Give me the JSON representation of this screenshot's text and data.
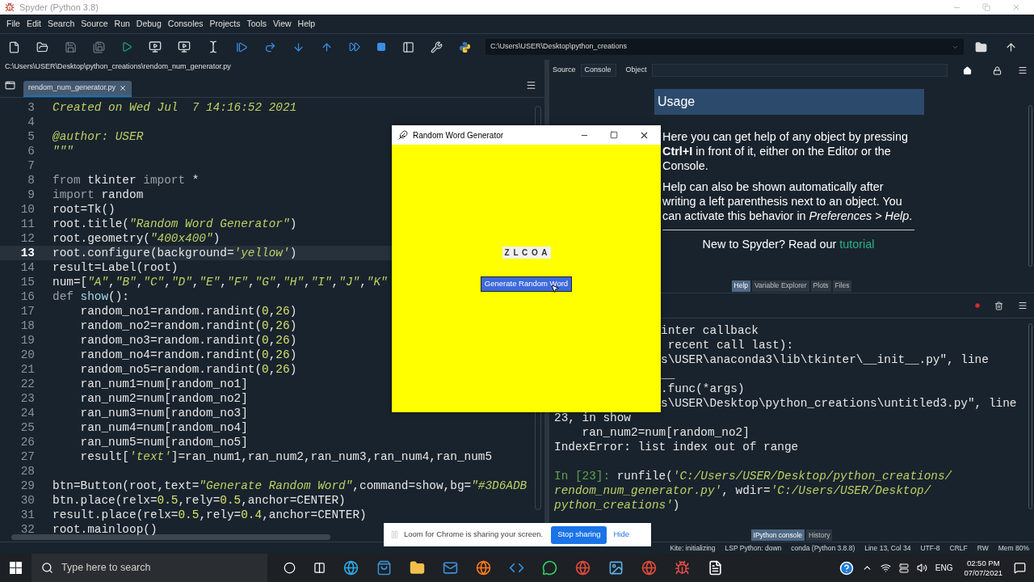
{
  "window": {
    "title": "Spyder (Python 3.8)"
  },
  "menu": [
    "File",
    "Edit",
    "Search",
    "Source",
    "Run",
    "Debug",
    "Consoles",
    "Projects",
    "Tools",
    "View",
    "Help"
  ],
  "toolbar": {
    "working_directory": "C:\\Users\\USER\\Desktop\\python_creations"
  },
  "editor": {
    "file_path": "C:\\Users\\USER\\Desktop\\python_creations\\rendom_num_generator.py",
    "tabs": [
      {
        "label": "rendom_num_generator.py",
        "selected": true
      }
    ],
    "lines": [
      {
        "number": "3",
        "current": false,
        "tokens": [
          {
            "kind": "doc",
            "text": "Created on Wed Jul  7 14:16:52 2021"
          }
        ]
      },
      {
        "number": "4",
        "current": false
      },
      {
        "number": "5",
        "current": false,
        "tokens": [
          {
            "kind": "doc",
            "text": "@author: USER"
          }
        ]
      },
      {
        "number": "6",
        "current": false,
        "tokens": [
          {
            "kind": "doc",
            "text": "\"\"\""
          }
        ]
      },
      {
        "number": "7",
        "current": false
      },
      {
        "number": "8",
        "current": false,
        "tokens": [
          {
            "kind": "kw",
            "text": "from"
          },
          {
            "kind": "plain",
            "text": " tkinter "
          },
          {
            "kind": "kw",
            "text": "import"
          },
          {
            "kind": "plain",
            "text": " *"
          }
        ]
      },
      {
        "number": "9",
        "current": false,
        "tokens": [
          {
            "kind": "kw",
            "text": "import"
          },
          {
            "kind": "plain",
            "text": " random"
          }
        ]
      },
      {
        "number": "10",
        "current": false,
        "tokens": [
          {
            "kind": "plain",
            "text": "root=Tk()"
          }
        ]
      },
      {
        "number": "11",
        "current": false,
        "tokens": [
          {
            "kind": "plain",
            "text": "root.title("
          },
          {
            "kind": "str",
            "text": "\"Random Word Generator\""
          },
          {
            "kind": "plain",
            "text": ")"
          }
        ]
      },
      {
        "number": "12",
        "current": false,
        "tokens": [
          {
            "kind": "plain",
            "text": "root.geometry("
          },
          {
            "kind": "str",
            "text": "\"400x400\""
          },
          {
            "kind": "plain",
            "text": ")"
          }
        ]
      },
      {
        "number": "13",
        "current": true,
        "tokens": [
          {
            "kind": "plain",
            "text": "root.configure(background="
          },
          {
            "kind": "str",
            "text": "'yellow'"
          },
          {
            "kind": "plain",
            "text": ")"
          }
        ]
      },
      {
        "number": "14",
        "current": false,
        "tokens": [
          {
            "kind": "plain",
            "text": "result=Label(root)"
          }
        ]
      },
      {
        "number": "15",
        "current": false,
        "tokens": [
          {
            "kind": "plain",
            "text": "num=["
          },
          {
            "kind": "str",
            "text": "\"A\""
          },
          {
            "kind": "plain",
            "text": ","
          },
          {
            "kind": "str",
            "text": "\"B\""
          },
          {
            "kind": "plain",
            "text": ","
          },
          {
            "kind": "str",
            "text": "\"C\""
          },
          {
            "kind": "plain",
            "text": ","
          },
          {
            "kind": "str",
            "text": "\"D\""
          },
          {
            "kind": "plain",
            "text": ","
          },
          {
            "kind": "str",
            "text": "\"E\""
          },
          {
            "kind": "plain",
            "text": ","
          },
          {
            "kind": "str",
            "text": "\"F\""
          },
          {
            "kind": "plain",
            "text": ","
          },
          {
            "kind": "str",
            "text": "\"G\""
          },
          {
            "kind": "plain",
            "text": ","
          },
          {
            "kind": "str",
            "text": "\"H\""
          },
          {
            "kind": "plain",
            "text": ","
          },
          {
            "kind": "str",
            "text": "\"I\""
          },
          {
            "kind": "plain",
            "text": ","
          },
          {
            "kind": "str",
            "text": "\"J\""
          },
          {
            "kind": "plain",
            "text": ","
          },
          {
            "kind": "str",
            "text": "\"K\""
          }
        ]
      },
      {
        "number": "16",
        "current": false,
        "tokens": [
          {
            "kind": "kw",
            "text": "def "
          },
          {
            "kind": "fn",
            "text": "show"
          },
          {
            "kind": "plain",
            "text": "():"
          }
        ]
      },
      {
        "number": "17",
        "current": false,
        "tokens": [
          {
            "kind": "plain",
            "text": "    random_no1=random.randint("
          },
          {
            "kind": "num",
            "text": "0"
          },
          {
            "kind": "plain",
            "text": ","
          },
          {
            "kind": "num",
            "text": "26"
          },
          {
            "kind": "plain",
            "text": ")"
          }
        ]
      },
      {
        "number": "18",
        "current": false,
        "tokens": [
          {
            "kind": "plain",
            "text": "    random_no2=random.randint("
          },
          {
            "kind": "num",
            "text": "0"
          },
          {
            "kind": "plain",
            "text": ","
          },
          {
            "kind": "num",
            "text": "26"
          },
          {
            "kind": "plain",
            "text": ")"
          }
        ]
      },
      {
        "number": "19",
        "current": false,
        "tokens": [
          {
            "kind": "plain",
            "text": "    random_no3=random.randint("
          },
          {
            "kind": "num",
            "text": "0"
          },
          {
            "kind": "plain",
            "text": ","
          },
          {
            "kind": "num",
            "text": "26"
          },
          {
            "kind": "plain",
            "text": ")"
          }
        ]
      },
      {
        "number": "20",
        "current": false,
        "tokens": [
          {
            "kind": "plain",
            "text": "    random_no4=random.randint("
          },
          {
            "kind": "num",
            "text": "0"
          },
          {
            "kind": "plain",
            "text": ","
          },
          {
            "kind": "num",
            "text": "26"
          },
          {
            "kind": "plain",
            "text": ")"
          }
        ]
      },
      {
        "number": "21",
        "current": false,
        "tokens": [
          {
            "kind": "plain",
            "text": "    random_no5=random.randint("
          },
          {
            "kind": "num",
            "text": "0"
          },
          {
            "kind": "plain",
            "text": ","
          },
          {
            "kind": "num",
            "text": "26"
          },
          {
            "kind": "plain",
            "text": ")"
          }
        ]
      },
      {
        "number": "22",
        "current": false,
        "tokens": [
          {
            "kind": "plain",
            "text": "    ran_num1=num[random_no1]"
          }
        ]
      },
      {
        "number": "23",
        "current": false,
        "tokens": [
          {
            "kind": "plain",
            "text": "    ran_num2=num[random_no2]"
          }
        ]
      },
      {
        "number": "24",
        "current": false,
        "tokens": [
          {
            "kind": "plain",
            "text": "    ran_num3=num[random_no3]"
          }
        ]
      },
      {
        "number": "25",
        "current": false,
        "tokens": [
          {
            "kind": "plain",
            "text": "    ran_num4=num[random_no4]"
          }
        ]
      },
      {
        "number": "26",
        "current": false,
        "tokens": [
          {
            "kind": "plain",
            "text": "    ran_num5=num[random_no5]"
          }
        ]
      },
      {
        "number": "27",
        "current": false,
        "tokens": [
          {
            "kind": "plain",
            "text": "    result["
          },
          {
            "kind": "str",
            "text": "'text'"
          },
          {
            "kind": "plain",
            "text": "]=ran_num1,ran_num2,ran_num3,ran_num4,ran_num5"
          }
        ]
      },
      {
        "number": "28",
        "current": false
      },
      {
        "number": "29",
        "current": false,
        "tokens": [
          {
            "kind": "plain",
            "text": "btn=Button(root,text="
          },
          {
            "kind": "str",
            "text": "\"Generate Random Word\""
          },
          {
            "kind": "plain",
            "text": ",command=show,bg="
          },
          {
            "kind": "str",
            "text": "\"#3D6ADB"
          }
        ]
      },
      {
        "number": "30",
        "current": false,
        "tokens": [
          {
            "kind": "plain",
            "text": "btn.place(relx="
          },
          {
            "kind": "num",
            "text": "0.5"
          },
          {
            "kind": "plain",
            "text": ",rely="
          },
          {
            "kind": "num",
            "text": "0.5"
          },
          {
            "kind": "plain",
            "text": ",anchor=CENTER)"
          }
        ]
      },
      {
        "number": "31",
        "current": false,
        "tokens": [
          {
            "kind": "plain",
            "text": "result.place(relx="
          },
          {
            "kind": "num",
            "text": "0.5"
          },
          {
            "kind": "plain",
            "text": ",rely="
          },
          {
            "kind": "num",
            "text": "0.4"
          },
          {
            "kind": "plain",
            "text": ",anchor=CENTER)"
          }
        ]
      },
      {
        "number": "32",
        "current": false,
        "tokens": [
          {
            "kind": "plain",
            "text": "root.mainloop()"
          }
        ]
      }
    ]
  },
  "help": {
    "source_label": "Source",
    "source_value": "Console",
    "object_label": "Object",
    "title": "Usage",
    "paragraphs": [
      "Here you can get help of any object by pressing **Ctrl+I** in front of it, either on the Editor or the Console.",
      "Help can also be shown automatically after writing a left parenthesis next to an object. You can activate this behavior in *Preferences > Help*."
    ],
    "footer_text": "New to Spyder? Read our",
    "footer_link": "tutorial",
    "tabs": [
      {
        "label": "Help",
        "selected": true
      },
      {
        "label": "Variable Explorer",
        "selected": false
      },
      {
        "label": "Plots",
        "selected": false
      },
      {
        "label": "Files",
        "selected": false
      }
    ]
  },
  "console": {
    "lines": [
      {
        "kind": "partial",
        "tokens": [
          {
            "kind": "plain",
            "text": "inter callback"
          }
        ]
      },
      {
        "kind": "partial",
        "tokens": [
          {
            "kind": "plain",
            "text": " recent call last):"
          }
        ]
      },
      {
        "kind": "partial",
        "tokens": [
          {
            "kind": "plain",
            "text": "s\\USER\\anaconda3\\lib\\tkinter\\__init__.py\", line"
          }
        ]
      },
      {
        "kind": "partial",
        "tokens": [
          {
            "kind": "plain",
            "text": "__"
          }
        ]
      },
      {
        "kind": "partial",
        "tokens": [
          {
            "kind": "plain",
            "text": ".func(*args)"
          }
        ]
      },
      {
        "kind": "partial",
        "tokens": [
          {
            "kind": "plain",
            "text": "s\\USER\\Desktop\\python_creations\\untitled3.py\", line"
          }
        ]
      },
      {
        "kind": "full",
        "tokens": [
          {
            "kind": "plain",
            "text": "23, in show"
          }
        ]
      },
      {
        "kind": "full",
        "tokens": [
          {
            "kind": "plain",
            "text": "    ran_num2=num[random_no2]"
          }
        ]
      },
      {
        "kind": "full",
        "tokens": [
          {
            "kind": "plain",
            "text": "IndexError: list index out of range"
          }
        ]
      },
      {
        "kind": "blank"
      },
      {
        "kind": "full",
        "tokens": [
          {
            "kind": "prompt",
            "text": "In [23]: "
          },
          {
            "kind": "plain",
            "text": "runfile("
          },
          {
            "kind": "str",
            "text": "'C:/Users/USER/Desktop/python_creations/"
          }
        ]
      },
      {
        "kind": "full",
        "tokens": [
          {
            "kind": "str",
            "text": "rendom_num_generator.py'"
          },
          {
            "kind": "plain",
            "text": ", wdir="
          },
          {
            "kind": "str",
            "text": "'C:/Users/USER/Desktop/"
          }
        ]
      },
      {
        "kind": "full",
        "tokens": [
          {
            "kind": "str",
            "text": "python_creations'"
          },
          {
            "kind": "plain",
            "text": ")"
          }
        ]
      }
    ],
    "tabs": [
      {
        "label": "IPython console",
        "selected": true
      },
      {
        "label": "History",
        "selected": false
      }
    ]
  },
  "status_bar": [
    "Kite: initializing",
    "LSP Python: down",
    "conda (Python 3.8.8)",
    "Line 13, Col 34",
    "UTF-8",
    "CRLF",
    "RW",
    "Mem 80%"
  ],
  "tk_window": {
    "title": "Random Word Generator",
    "result": "Z L C O A",
    "button": "Generate Random Word"
  },
  "loom_bar": {
    "message": "Loom for Chrome is sharing your screen.",
    "stop_button": "Stop sharing",
    "hide_link": "Hide"
  },
  "taskbar": {
    "search_placeholder": "Type here to search",
    "language": "ENG",
    "time": "02:50 PM",
    "date": "07/07/2021"
  }
}
